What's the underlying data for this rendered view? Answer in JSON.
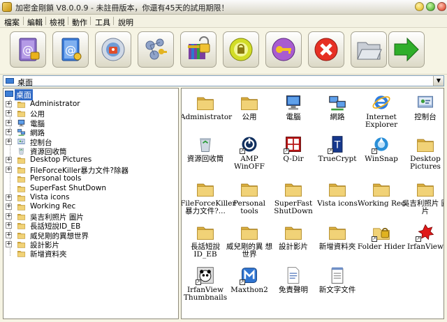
{
  "window": {
    "title": "加密金剛鎖 V8.0.0.9 - 未註冊版本，你還有45天的試用期限！"
  },
  "menu": [
    "檔案",
    "編輯",
    "檢視",
    "動作",
    "工具",
    "說明"
  ],
  "toolbar": [
    {
      "icon": "encrypt-book-icon"
    },
    {
      "icon": "decrypt-book-icon"
    },
    {
      "icon": "drive-lock-icon"
    },
    {
      "icon": "network-key-icon"
    },
    {
      "icon": "archive-lock-icon"
    },
    {
      "icon": "amp-lock-icon"
    },
    {
      "icon": "key-icon"
    },
    {
      "icon": "stop-icon"
    },
    {
      "icon": "folder-open-icon"
    },
    {
      "icon": "exit-arrow-icon"
    }
  ],
  "address": {
    "value": "桌面"
  },
  "tree": {
    "root": "桌面",
    "items": [
      {
        "label": "Administrator",
        "icon": "folder",
        "expandable": true
      },
      {
        "label": "公用",
        "icon": "folder",
        "expandable": true
      },
      {
        "label": "電腦",
        "icon": "computer",
        "expandable": true
      },
      {
        "label": "網路",
        "icon": "network",
        "expandable": true
      },
      {
        "label": "控制台",
        "icon": "control-panel",
        "expandable": true
      },
      {
        "label": "資源回收筒",
        "icon": "recycle-bin",
        "expandable": false
      },
      {
        "label": "Desktop Pictures",
        "icon": "folder",
        "expandable": true
      },
      {
        "label": "FileForceKiller暴力文件?除器",
        "icon": "folder",
        "expandable": true
      },
      {
        "label": "Personal tools",
        "icon": "folder",
        "expandable": false
      },
      {
        "label": "SuperFast ShutDown",
        "icon": "folder",
        "expandable": false
      },
      {
        "label": "Vista icons",
        "icon": "folder",
        "expandable": true
      },
      {
        "label": "Working Rec",
        "icon": "folder",
        "expandable": true
      },
      {
        "label": "吳吉利照片 圖片",
        "icon": "folder",
        "expandable": true
      },
      {
        "label": "長話短說ID_EB",
        "icon": "folder",
        "expandable": true
      },
      {
        "label": "威兒剛的異想世界",
        "icon": "folder",
        "expandable": true
      },
      {
        "label": "設計影片",
        "icon": "folder",
        "expandable": true
      },
      {
        "label": "新增資料夾",
        "icon": "folder",
        "expandable": false
      }
    ]
  },
  "files": [
    {
      "label": "Administrator",
      "icon": "folder"
    },
    {
      "label": "公用",
      "icon": "folder"
    },
    {
      "label": "電腦",
      "icon": "computer"
    },
    {
      "label": "網路",
      "icon": "network"
    },
    {
      "label": "Internet Explorer",
      "icon": "ie"
    },
    {
      "label": "控制台",
      "icon": "control-panel"
    },
    {
      "label": "資源回收筒",
      "icon": "recycle-bin"
    },
    {
      "label": "AMP WinOFF",
      "icon": "power",
      "shortcut": true
    },
    {
      "label": "Q-Dir",
      "icon": "qdir",
      "shortcut": true
    },
    {
      "label": "TrueCrypt",
      "icon": "truecrypt",
      "shortcut": true
    },
    {
      "label": "WinSnap",
      "icon": "winsnap",
      "shortcut": true
    },
    {
      "label": "Desktop Pictures",
      "icon": "folder"
    },
    {
      "label": "FileForceKiller 暴力文件?...",
      "icon": "folder"
    },
    {
      "label": "Personal tools",
      "icon": "folder"
    },
    {
      "label": "SuperFast ShutDown",
      "icon": "folder"
    },
    {
      "label": "Vista icons",
      "icon": "folder"
    },
    {
      "label": "Working Rec",
      "icon": "folder"
    },
    {
      "label": "吳吉利照片 圖片",
      "icon": "folder"
    },
    {
      "label": "長話短說 ID_EB",
      "icon": "folder"
    },
    {
      "label": "威兒剛的異 想世界",
      "icon": "folder"
    },
    {
      "label": "設計影片",
      "icon": "folder"
    },
    {
      "label": "新增資料夾",
      "icon": "folder"
    },
    {
      "label": "Folder Hider",
      "icon": "folder-hider",
      "shortcut": true
    },
    {
      "label": "IrfanView",
      "icon": "irfanview",
      "shortcut": true
    },
    {
      "label": "IrfanView Thumbnails",
      "icon": "panda",
      "shortcut": true
    },
    {
      "label": "Maxthon2",
      "icon": "maxthon",
      "shortcut": true
    },
    {
      "label": "免責聲明",
      "icon": "document"
    },
    {
      "label": "新文字文件",
      "icon": "notepad"
    }
  ],
  "colors": {
    "selection": "#316ac5",
    "folder": "#e9c45c",
    "background": "#f6f4e4"
  }
}
